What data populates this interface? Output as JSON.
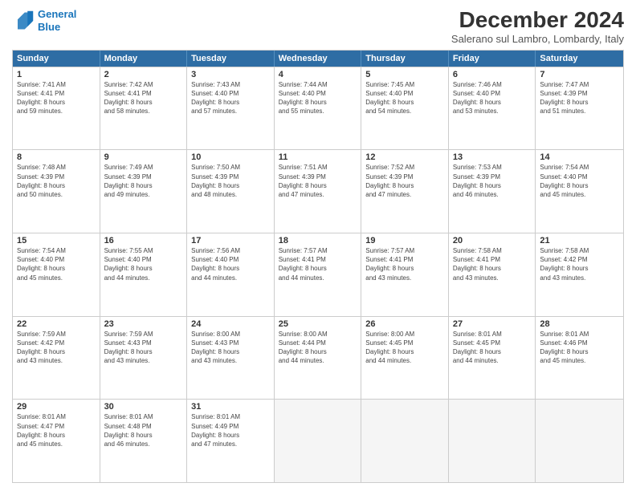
{
  "header": {
    "logo_line1": "General",
    "logo_line2": "Blue",
    "month_title": "December 2024",
    "location": "Salerano sul Lambro, Lombardy, Italy"
  },
  "days_of_week": [
    "Sunday",
    "Monday",
    "Tuesday",
    "Wednesday",
    "Thursday",
    "Friday",
    "Saturday"
  ],
  "weeks": [
    [
      {
        "day": "1",
        "sunrise": "Sunrise: 7:41 AM",
        "sunset": "Sunset: 4:41 PM",
        "daylight": "Daylight: 8 hours and 59 minutes."
      },
      {
        "day": "2",
        "sunrise": "Sunrise: 7:42 AM",
        "sunset": "Sunset: 4:41 PM",
        "daylight": "Daylight: 8 hours and 58 minutes."
      },
      {
        "day": "3",
        "sunrise": "Sunrise: 7:43 AM",
        "sunset": "Sunset: 4:40 PM",
        "daylight": "Daylight: 8 hours and 57 minutes."
      },
      {
        "day": "4",
        "sunrise": "Sunrise: 7:44 AM",
        "sunset": "Sunset: 4:40 PM",
        "daylight": "Daylight: 8 hours and 55 minutes."
      },
      {
        "day": "5",
        "sunrise": "Sunrise: 7:45 AM",
        "sunset": "Sunset: 4:40 PM",
        "daylight": "Daylight: 8 hours and 54 minutes."
      },
      {
        "day": "6",
        "sunrise": "Sunrise: 7:46 AM",
        "sunset": "Sunset: 4:40 PM",
        "daylight": "Daylight: 8 hours and 53 minutes."
      },
      {
        "day": "7",
        "sunrise": "Sunrise: 7:47 AM",
        "sunset": "Sunset: 4:39 PM",
        "daylight": "Daylight: 8 hours and 51 minutes."
      }
    ],
    [
      {
        "day": "8",
        "sunrise": "Sunrise: 7:48 AM",
        "sunset": "Sunset: 4:39 PM",
        "daylight": "Daylight: 8 hours and 50 minutes."
      },
      {
        "day": "9",
        "sunrise": "Sunrise: 7:49 AM",
        "sunset": "Sunset: 4:39 PM",
        "daylight": "Daylight: 8 hours and 49 minutes."
      },
      {
        "day": "10",
        "sunrise": "Sunrise: 7:50 AM",
        "sunset": "Sunset: 4:39 PM",
        "daylight": "Daylight: 8 hours and 48 minutes."
      },
      {
        "day": "11",
        "sunrise": "Sunrise: 7:51 AM",
        "sunset": "Sunset: 4:39 PM",
        "daylight": "Daylight: 8 hours and 47 minutes."
      },
      {
        "day": "12",
        "sunrise": "Sunrise: 7:52 AM",
        "sunset": "Sunset: 4:39 PM",
        "daylight": "Daylight: 8 hours and 47 minutes."
      },
      {
        "day": "13",
        "sunrise": "Sunrise: 7:53 AM",
        "sunset": "Sunset: 4:39 PM",
        "daylight": "Daylight: 8 hours and 46 minutes."
      },
      {
        "day": "14",
        "sunrise": "Sunrise: 7:54 AM",
        "sunset": "Sunset: 4:40 PM",
        "daylight": "Daylight: 8 hours and 45 minutes."
      }
    ],
    [
      {
        "day": "15",
        "sunrise": "Sunrise: 7:54 AM",
        "sunset": "Sunset: 4:40 PM",
        "daylight": "Daylight: 8 hours and 45 minutes."
      },
      {
        "day": "16",
        "sunrise": "Sunrise: 7:55 AM",
        "sunset": "Sunset: 4:40 PM",
        "daylight": "Daylight: 8 hours and 44 minutes."
      },
      {
        "day": "17",
        "sunrise": "Sunrise: 7:56 AM",
        "sunset": "Sunset: 4:40 PM",
        "daylight": "Daylight: 8 hours and 44 minutes."
      },
      {
        "day": "18",
        "sunrise": "Sunrise: 7:57 AM",
        "sunset": "Sunset: 4:41 PM",
        "daylight": "Daylight: 8 hours and 44 minutes."
      },
      {
        "day": "19",
        "sunrise": "Sunrise: 7:57 AM",
        "sunset": "Sunset: 4:41 PM",
        "daylight": "Daylight: 8 hours and 43 minutes."
      },
      {
        "day": "20",
        "sunrise": "Sunrise: 7:58 AM",
        "sunset": "Sunset: 4:41 PM",
        "daylight": "Daylight: 8 hours and 43 minutes."
      },
      {
        "day": "21",
        "sunrise": "Sunrise: 7:58 AM",
        "sunset": "Sunset: 4:42 PM",
        "daylight": "Daylight: 8 hours and 43 minutes."
      }
    ],
    [
      {
        "day": "22",
        "sunrise": "Sunrise: 7:59 AM",
        "sunset": "Sunset: 4:42 PM",
        "daylight": "Daylight: 8 hours and 43 minutes."
      },
      {
        "day": "23",
        "sunrise": "Sunrise: 7:59 AM",
        "sunset": "Sunset: 4:43 PM",
        "daylight": "Daylight: 8 hours and 43 minutes."
      },
      {
        "day": "24",
        "sunrise": "Sunrise: 8:00 AM",
        "sunset": "Sunset: 4:43 PM",
        "daylight": "Daylight: 8 hours and 43 minutes."
      },
      {
        "day": "25",
        "sunrise": "Sunrise: 8:00 AM",
        "sunset": "Sunset: 4:44 PM",
        "daylight": "Daylight: 8 hours and 44 minutes."
      },
      {
        "day": "26",
        "sunrise": "Sunrise: 8:00 AM",
        "sunset": "Sunset: 4:45 PM",
        "daylight": "Daylight: 8 hours and 44 minutes."
      },
      {
        "day": "27",
        "sunrise": "Sunrise: 8:01 AM",
        "sunset": "Sunset: 4:45 PM",
        "daylight": "Daylight: 8 hours and 44 minutes."
      },
      {
        "day": "28",
        "sunrise": "Sunrise: 8:01 AM",
        "sunset": "Sunset: 4:46 PM",
        "daylight": "Daylight: 8 hours and 45 minutes."
      }
    ],
    [
      {
        "day": "29",
        "sunrise": "Sunrise: 8:01 AM",
        "sunset": "Sunset: 4:47 PM",
        "daylight": "Daylight: 8 hours and 45 minutes."
      },
      {
        "day": "30",
        "sunrise": "Sunrise: 8:01 AM",
        "sunset": "Sunset: 4:48 PM",
        "daylight": "Daylight: 8 hours and 46 minutes."
      },
      {
        "day": "31",
        "sunrise": "Sunrise: 8:01 AM",
        "sunset": "Sunset: 4:49 PM",
        "daylight": "Daylight: 8 hours and 47 minutes."
      },
      null,
      null,
      null,
      null
    ]
  ]
}
